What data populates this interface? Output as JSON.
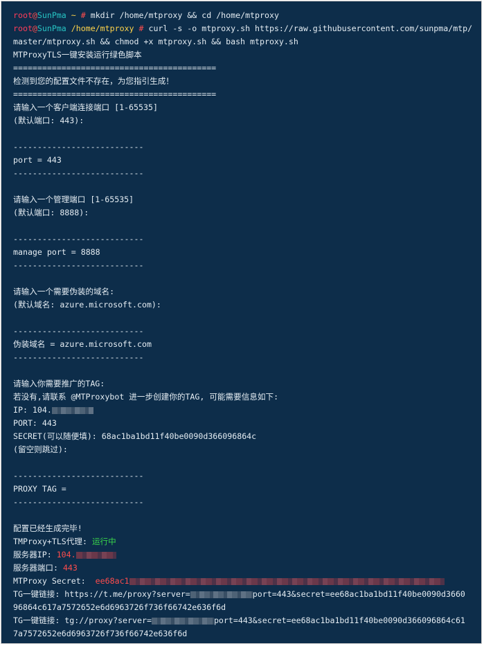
{
  "prompt": {
    "user": "root",
    "at": "@",
    "host": "SunPma",
    "home_path": " ~ ",
    "hash": "#",
    "dir_path": " /home/mtproxy "
  },
  "commands": {
    "cmd1": " mkdir /home/mtproxy && cd /home/mtproxy",
    "cmd2_part1": " curl -s -o mtproxy.sh https://raw.githubusercontent.com/sunpma/mtp/",
    "cmd2_part2": "master/mtproxy.sh && chmod +x mtproxy.sh && bash mtproxy.sh"
  },
  "output": {
    "title": "MTProxyTLS一键安装运行绿色脚本",
    "sep_long": "==========================================",
    "config_missing": "检测到您的配置文件不存在，为您指引生成！",
    "sep_short": "---------------------------",
    "client_port_prompt": "请输入一个客户端连接端口 [1-65535]",
    "client_port_default": "(默认端口: 443):",
    "client_port_result": "port = 443",
    "manage_port_prompt": "请输入一个管理端口 [1-65535]",
    "manage_port_default": "(默认端口: 8888):",
    "manage_port_result": "manage port = 8888",
    "domain_prompt": "请输入一个需要伪装的域名:",
    "domain_default": "(默认域名: azure.microsoft.com):",
    "domain_result": "伪装域名 = azure.microsoft.com",
    "tag_prompt": "请输入你需要推广的TAG:",
    "tag_hint": "若没有,请联系 @MTProxybot 进一步创建你的TAG, 可能需要信息如下:",
    "ip_label": "IP: 104.",
    "port_line": "PORT: 443",
    "secret_line": "SECRET(可以随便填): 68ac1ba1bd11f40be0090d366096864c",
    "skip_hint": "(留空则跳过):",
    "proxy_tag_line": "PROXY TAG =",
    "done": "配置已经生成完毕!",
    "status_label": "TMProxy+TLS代理: ",
    "status_value": "运行中",
    "server_ip_label": "服务器IP: ",
    "server_ip_value": "104.",
    "server_port_label": "服务器端口: ",
    "server_port_value": "443",
    "secret_label": "MTProxy Secret:  ",
    "secret_value": "ee68ac1",
    "tg_link1_label": "TG一键链接: https://t.me/proxy?server=",
    "tg_link1_rest": "port=443&secret=ee68ac1ba1bd11f40be0090d3660",
    "tg_link1_cont": "96864c617a7572652e6d6963726f736f66742e636f6d",
    "tg_link2_label": "TG一键链接: tg://proxy?server=",
    "tg_link2_rest": "port=443&secret=ee68ac1ba1bd11f40be0090d366096864c61",
    "tg_link2_cont": "7a7572652e6d6963726f736f66742e636f6d"
  }
}
